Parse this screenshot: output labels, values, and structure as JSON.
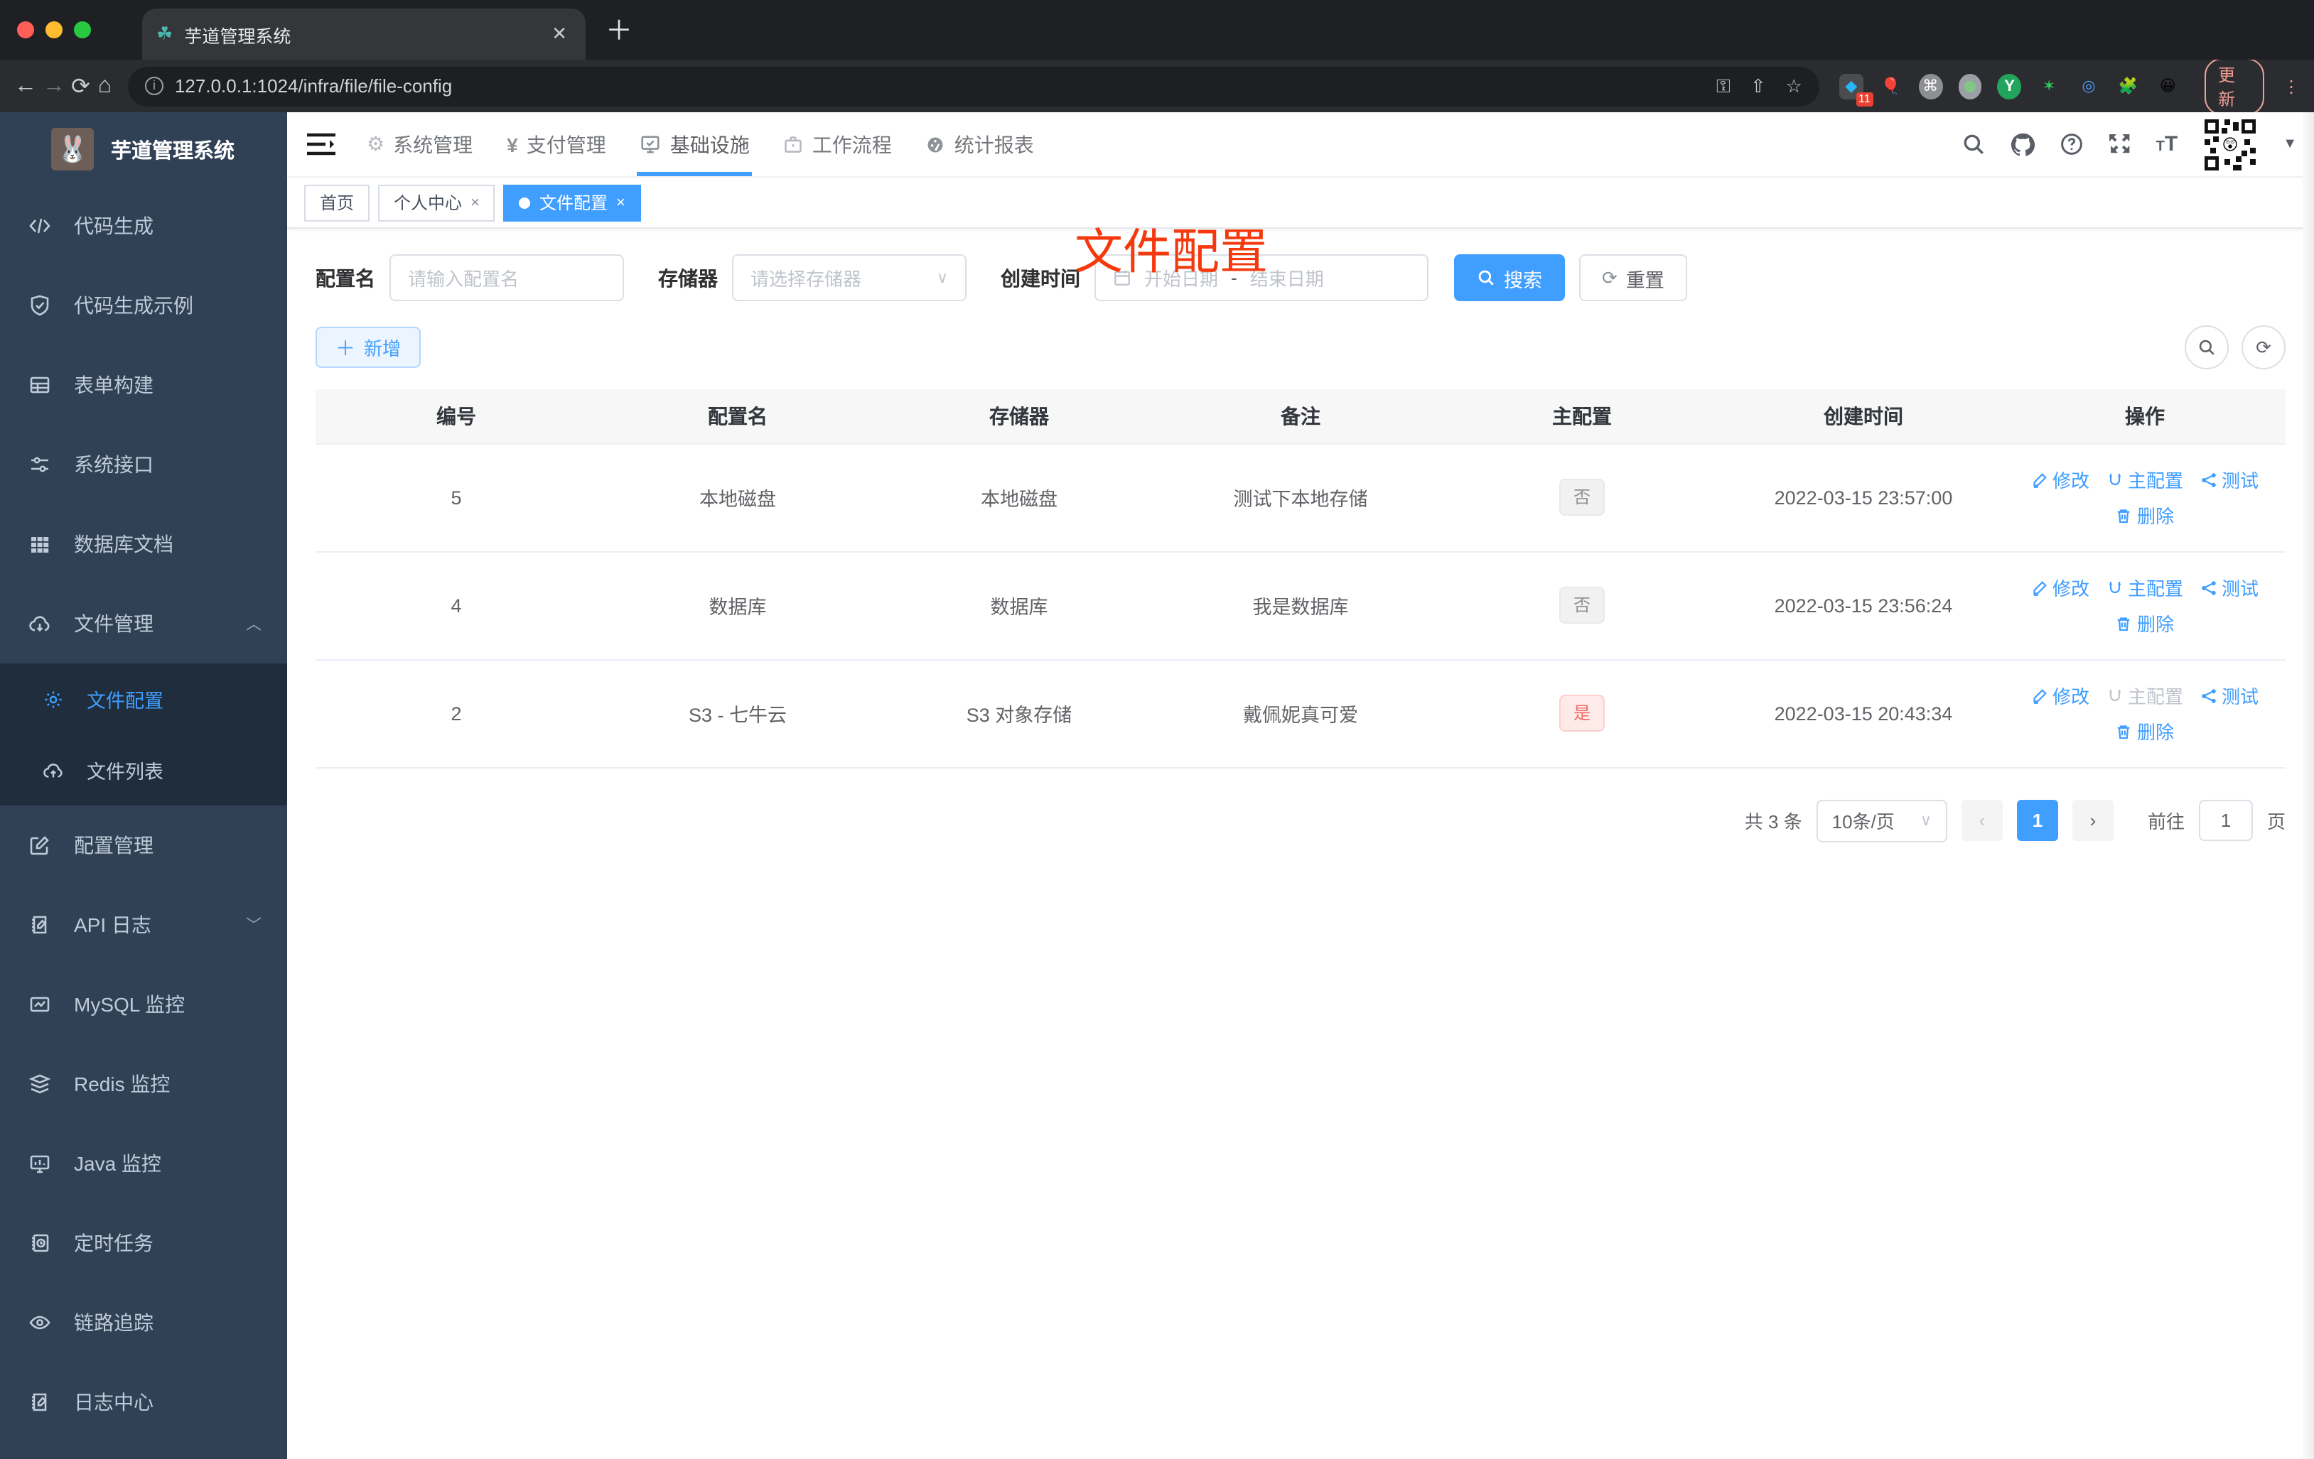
{
  "browser": {
    "tab_title": "芋道管理系统",
    "close_glyph": "✕",
    "new_tab_glyph": "＋",
    "url": "127.0.0.1:1024/infra/file/file-config",
    "ext_badge": "11",
    "update_label": "更新"
  },
  "sidebar": {
    "title": "芋道管理系统",
    "items": [
      {
        "label": "代码生成"
      },
      {
        "label": "代码生成示例"
      },
      {
        "label": "表单构建"
      },
      {
        "label": "系统接口"
      },
      {
        "label": "数据库文档"
      },
      {
        "label": "文件管理"
      },
      {
        "label": "配置管理"
      },
      {
        "label": "API 日志"
      },
      {
        "label": "MySQL 监控"
      },
      {
        "label": "Redis 监控"
      },
      {
        "label": "Java 监控"
      },
      {
        "label": "定时任务"
      },
      {
        "label": "链路追踪"
      },
      {
        "label": "日志中心"
      }
    ],
    "sub_items": [
      {
        "label": "文件配置"
      },
      {
        "label": "文件列表"
      }
    ]
  },
  "nav": {
    "items": [
      {
        "label": "系统管理"
      },
      {
        "label": "支付管理"
      },
      {
        "label": "基础设施"
      },
      {
        "label": "工作流程"
      },
      {
        "label": "统计报表"
      }
    ]
  },
  "tags": {
    "home": "首页",
    "profile": "个人中心",
    "current": "文件配置",
    "close_glyph": "×"
  },
  "overlay_title": "文件配置",
  "filter": {
    "name_label": "配置名",
    "name_placeholder": "请输入配置名",
    "storage_label": "存储器",
    "storage_placeholder": "请选择存储器",
    "time_label": "创建时间",
    "start_placeholder": "开始日期",
    "range_separator": "-",
    "end_placeholder": "结束日期",
    "search_label": "搜索",
    "reset_label": "重置"
  },
  "toolbar": {
    "add_label": "新增"
  },
  "table": {
    "headers": [
      "编号",
      "配置名",
      "存储器",
      "备注",
      "主配置",
      "创建时间",
      "操作"
    ],
    "rows": [
      {
        "id": "5",
        "name": "本地磁盘",
        "storage": "本地磁盘",
        "remark": "测试下本地存储",
        "master": "否",
        "time": "2022-03-15 23:57:00"
      },
      {
        "id": "4",
        "name": "数据库",
        "storage": "数据库",
        "remark": "我是数据库",
        "master": "否",
        "time": "2022-03-15 23:56:24"
      },
      {
        "id": "2",
        "name": "S3 - 七牛云",
        "storage": "S3 对象存储",
        "remark": "戴佩妮真可爱",
        "master": "是",
        "time": "2022-03-15 20:43:34"
      }
    ],
    "actions": {
      "edit": "修改",
      "master": "主配置",
      "test": "测试",
      "delete": "删除"
    }
  },
  "pagination": {
    "total": "共 3 条",
    "page_size": "10条/页",
    "current_page": "1",
    "goto_label": "前往",
    "goto_value": "1",
    "page_unit": "页"
  },
  "colors": {
    "accent": "#409eff",
    "danger": "#f56c6c",
    "sidebar_bg": "#304156",
    "submenu_bg": "#1f2d3d",
    "overlay_red": "#f5390e"
  }
}
